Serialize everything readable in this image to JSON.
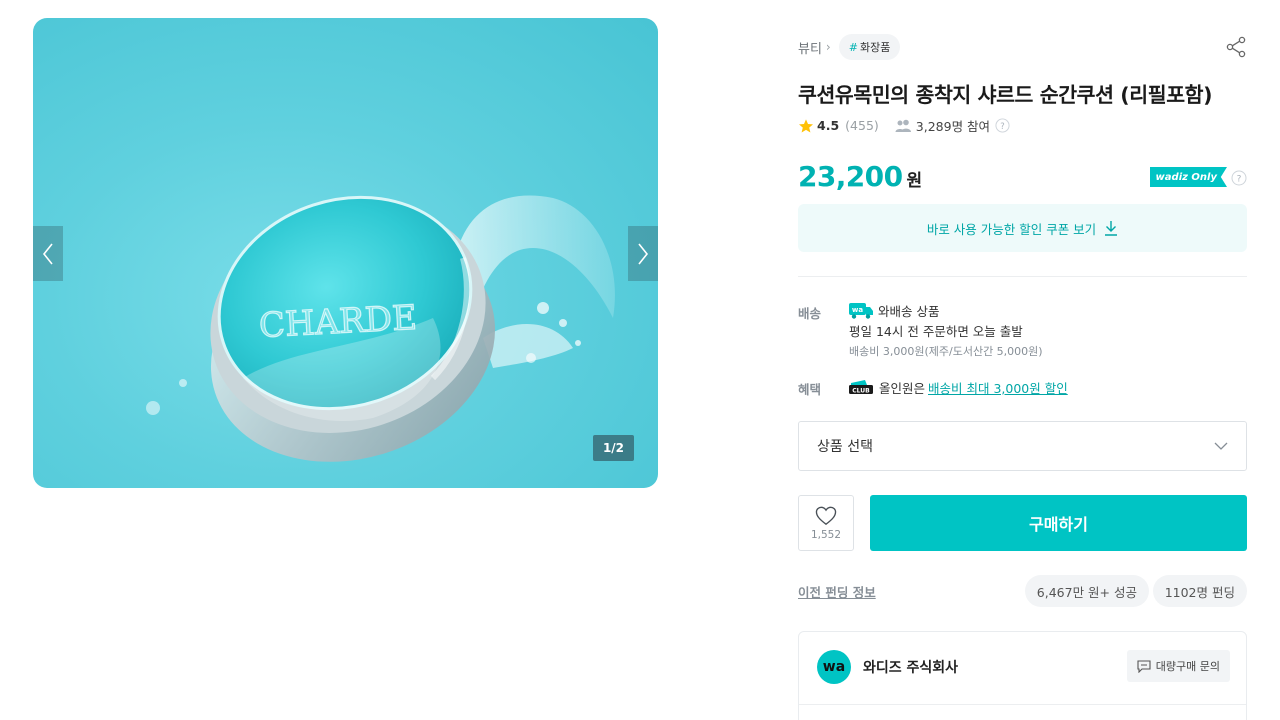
{
  "gallery": {
    "brand_text": "CHAR",
    "brand_text_end": "DE",
    "page_indicator": "1/2"
  },
  "breadcrumb": {
    "category": "뷰티",
    "tag_hash": "#",
    "tag": "화장품"
  },
  "product": {
    "title": "쿠션유목민의 종착지 샤르드 순간쿠션 (리필포함)",
    "rating": "4.5",
    "rating_count": "(455)",
    "participants": "3,289명 참여",
    "price": "23,200",
    "price_unit": "원",
    "wadiz_only": "wadiz Only"
  },
  "coupon": {
    "label": "바로 사용 가능한 할인 쿠폰 보기"
  },
  "shipping": {
    "label": "배송",
    "badge": "wa",
    "type": "와배송 상품",
    "schedule": "평일 14시 전 주문하면 오늘 출발",
    "fee": "배송비 3,000원(제주/도서산간 5,000원)"
  },
  "benefit": {
    "label": "혜택",
    "badge": "CLUB",
    "prefix": "올인원은",
    "link": "배송비 최대 3,000원 할인"
  },
  "option_select": {
    "placeholder": "상품 선택"
  },
  "actions": {
    "like_count": "1,552",
    "buy_label": "구매하기"
  },
  "funding_info": {
    "prev_link": "이전 펀딩 정보",
    "amount": "6,467만 원+ 성공",
    "people": "1102명 펀딩"
  },
  "maker": {
    "logo": "wa",
    "name": "와디즈 주식회사",
    "bulk_inquiry": "대량구매 문의"
  },
  "colors": {
    "accent": "#00c4c4",
    "accent_text": "#00b2b2",
    "star": "#ffc107"
  }
}
